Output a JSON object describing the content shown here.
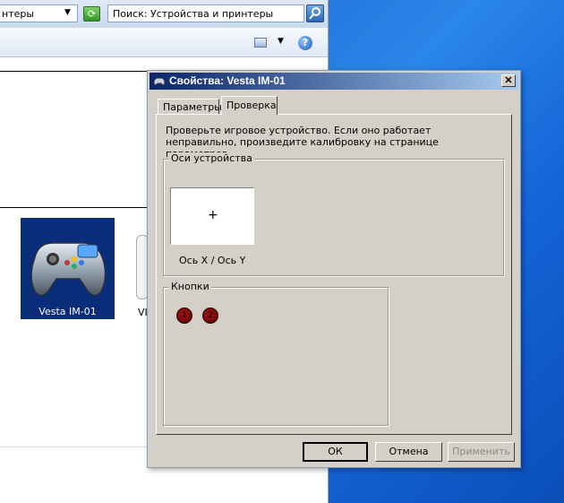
{
  "explorer": {
    "crumb_text": "нтеры",
    "search_placeholder": "Поиск: Устройства и принтеры",
    "device_label": "Vesta IM-01",
    "device2_label": "VI"
  },
  "dialog": {
    "title": "Свойства: Vesta IM-01",
    "close_label": "✕",
    "tabs": [
      {
        "label": "Параметры"
      },
      {
        "label": "Проверка"
      }
    ],
    "active_tab": "Проверка",
    "description": "Проверьте игровое устройство. Если оно работает неправильно, произведите калибровку на странице параметров.",
    "axes_group_title": "Оси устройства",
    "axes_caption": "Ось X / Ось Y",
    "crosshair": "+",
    "buttons_group_title": "Кнопки",
    "button_indicators": [
      "1",
      "2"
    ],
    "ok_label": "ОК",
    "cancel_label": "Отмена",
    "apply_label": "Применить"
  }
}
